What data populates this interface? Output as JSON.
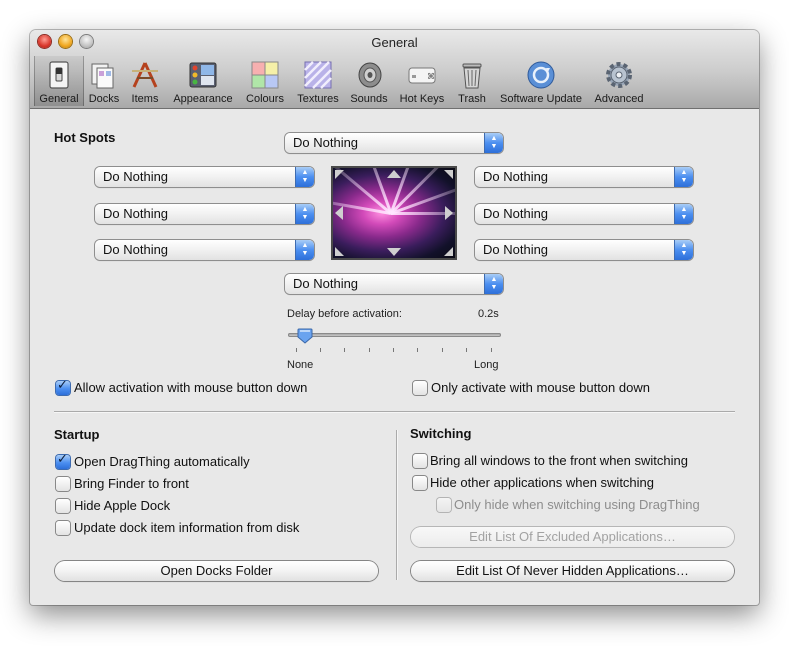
{
  "window": {
    "title": "General"
  },
  "toolbar": {
    "items": [
      {
        "label": "General",
        "icon": "general-switch-icon"
      },
      {
        "label": "Docks",
        "icon": "docks-icon"
      },
      {
        "label": "Items",
        "icon": "items-tools-icon"
      },
      {
        "label": "Appearance",
        "icon": "appearance-icon"
      },
      {
        "label": "Colours",
        "icon": "colours-icon"
      },
      {
        "label": "Textures",
        "icon": "textures-icon"
      },
      {
        "label": "Sounds",
        "icon": "speaker-icon"
      },
      {
        "label": "Hot Keys",
        "icon": "keyboard-key-icon"
      },
      {
        "label": "Trash",
        "icon": "trash-icon"
      },
      {
        "label": "Software Update",
        "icon": "software-update-icon"
      },
      {
        "label": "Advanced",
        "icon": "gear-icon"
      }
    ],
    "selected": "General"
  },
  "hot_spots": {
    "label": "Hot Spots",
    "top": "Do Nothing",
    "left_top": "Do Nothing",
    "left_middle": "Do Nothing",
    "left_bottom": "Do Nothing",
    "right_top": "Do Nothing",
    "right_middle": "Do Nothing",
    "right_bottom": "Do Nothing",
    "bottom": "Do Nothing"
  },
  "delay": {
    "label": "Delay before activation:",
    "value": "0.2s",
    "min_label": "None",
    "max_label": "Long",
    "level": 0.08
  },
  "activation": {
    "allow_with_mouse_down": {
      "label": "Allow activation with mouse button down",
      "checked": true
    },
    "only_with_mouse_down": {
      "label": "Only activate with mouse button down",
      "checked": false
    }
  },
  "startup": {
    "heading": "Startup",
    "options": [
      {
        "label": "Open DragThing automatically",
        "checked": true
      },
      {
        "label": "Bring Finder to front",
        "checked": false
      },
      {
        "label": "Hide Apple Dock",
        "checked": false
      },
      {
        "label": "Update dock item information from disk",
        "checked": false
      }
    ],
    "open_docks_button": "Open Docks Folder"
  },
  "switching": {
    "heading": "Switching",
    "bring_all_windows": {
      "label": "Bring all windows to the front when switching",
      "checked": false
    },
    "hide_other_apps": {
      "label": "Hide other applications when switching",
      "checked": false
    },
    "only_hide_dragthing": {
      "label": "Only hide when switching using DragThing",
      "checked": false,
      "enabled": false
    },
    "excluded_button": "Edit List Of Excluded Applications…",
    "never_hidden_button": "Edit List Of Never Hidden Applications…"
  },
  "colors": {
    "accent": "#4c8ff0",
    "window_bg": "#e8e8e8"
  }
}
